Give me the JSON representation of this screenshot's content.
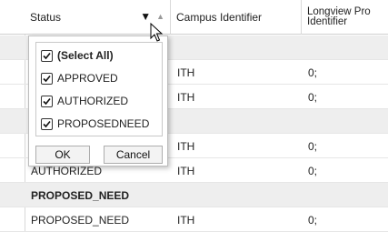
{
  "header": {
    "status_label": "Status",
    "campus_label": "Campus Identifier",
    "longview_label": "Longview Pro Identifier"
  },
  "rows": [
    {
      "type": "group",
      "status": "",
      "campus": "",
      "longview": ""
    },
    {
      "type": "data",
      "status": "",
      "campus": "ITH",
      "longview": "0;"
    },
    {
      "type": "data",
      "status": "",
      "campus": "ITH",
      "longview": "0;"
    },
    {
      "type": "group",
      "status": "",
      "campus": "",
      "longview": ""
    },
    {
      "type": "data",
      "status": "",
      "campus": "ITH",
      "longview": "0;"
    },
    {
      "type": "data",
      "status": "AUTHORIZED",
      "campus": "ITH",
      "longview": "0;"
    },
    {
      "type": "group",
      "status": "PROPOSED_NEED",
      "campus": "",
      "longview": ""
    },
    {
      "type": "data",
      "status": "PROPOSED_NEED",
      "campus": "ITH",
      "longview": "0;"
    }
  ],
  "filter_popup": {
    "options": [
      {
        "label": "(Select All)",
        "checked": true
      },
      {
        "label": "APPROVED",
        "checked": true
      },
      {
        "label": "AUTHORIZED",
        "checked": true
      },
      {
        "label": "PROPOSEDNEED",
        "checked": true
      }
    ],
    "ok_label": "OK",
    "cancel_label": "Cancel"
  }
}
